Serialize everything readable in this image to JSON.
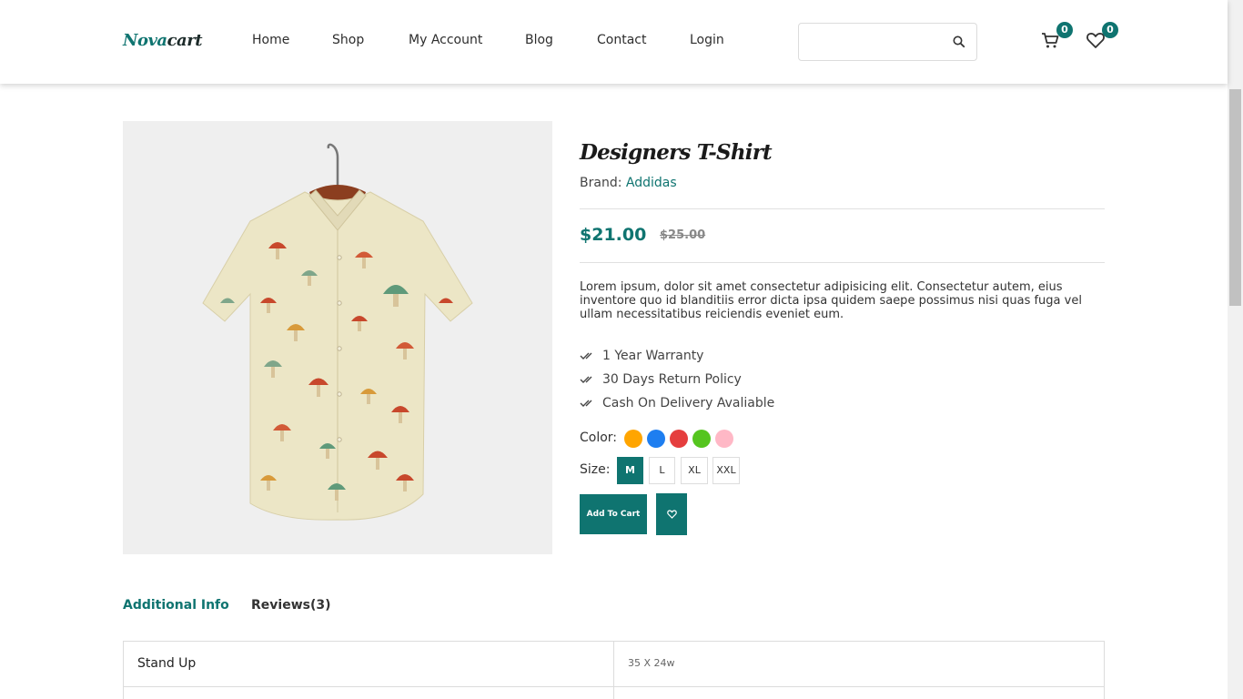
{
  "logo": {
    "part1": "Nova",
    "part2": "cart"
  },
  "nav": [
    "Home",
    "Shop",
    "My Account",
    "Blog",
    "Contact",
    "Login"
  ],
  "search": {
    "placeholder": "",
    "icon": "search-icon"
  },
  "header_icons": {
    "cart_count": "0",
    "wishlist_count": "0"
  },
  "product": {
    "title": "Designers T-Shirt",
    "brand_label": "Brand: ",
    "brand": "Addidas",
    "price": "$21.00",
    "old_price": "$25.00",
    "description": "Lorem ipsum, dolor sit amet consectetur adipisicing elit. Consectetur autem, eius inventore quo id blanditiis error dicta ipsa quidem saepe possimus nisi quas fuga vel ullam necessitatibus reiciendis eveniet eum.",
    "features": [
      "1 Year Warranty",
      "30 Days Return Policy",
      "Cash On Delivery Avaliable"
    ],
    "color_label": "Color:",
    "colors": [
      "#ffa500",
      "#1e7ef0",
      "#e53e3e",
      "#55c51f",
      "#ffb8c6"
    ],
    "size_label": "Size:",
    "sizes": [
      "M",
      "L",
      "XL",
      "XXL"
    ],
    "selected_size": "M",
    "add_to_cart": "Add To Cart"
  },
  "tabs": [
    {
      "label": "Additional Info",
      "active": true
    },
    {
      "label": "Reviews(3)",
      "active": false
    }
  ],
  "info_table": [
    {
      "key": "Stand Up",
      "value": "35 X 24w"
    },
    {
      "key": "",
      "value": ""
    }
  ],
  "colors": {
    "accent": "#0f7470"
  }
}
